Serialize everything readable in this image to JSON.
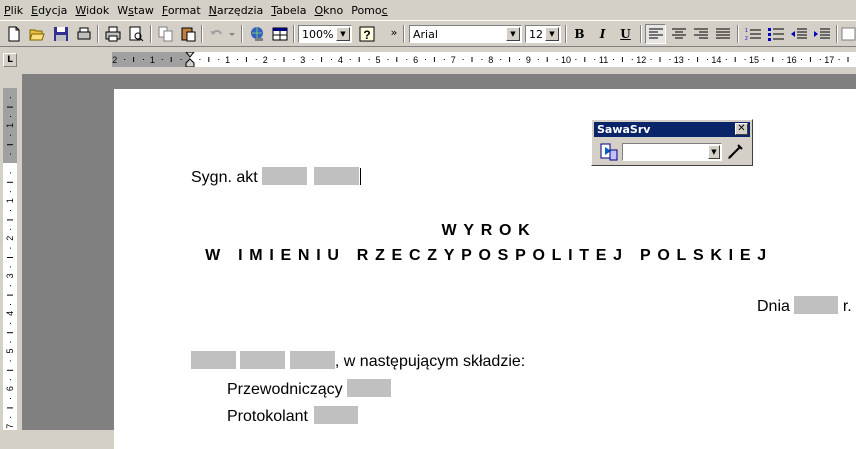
{
  "menu": [
    {
      "pre": "",
      "acc": "P",
      "post": "lik"
    },
    {
      "pre": "",
      "acc": "E",
      "post": "dycja"
    },
    {
      "pre": "",
      "acc": "W",
      "post": "idok"
    },
    {
      "pre": "W",
      "acc": "s",
      "post": "taw"
    },
    {
      "pre": "",
      "acc": "F",
      "post": "ormat"
    },
    {
      "pre": "",
      "acc": "N",
      "post": "arzędzia"
    },
    {
      "pre": "",
      "acc": "T",
      "post": "abela"
    },
    {
      "pre": "",
      "acc": "O",
      "post": "kno"
    },
    {
      "pre": "Pomo",
      "acc": "c",
      "post": ""
    }
  ],
  "toolbar": {
    "zoom": "100%",
    "font": "Arial",
    "size": "12",
    "bold": "B",
    "italic": "I",
    "underline": "U",
    "more": "»"
  },
  "ruler": {
    "corner": "L",
    "h_labels": [
      "2",
      "1",
      "1",
      "2",
      "3",
      "4",
      "5",
      "6",
      "7",
      "8",
      "9",
      "10",
      "11",
      "12",
      "13",
      "14",
      "15",
      "16",
      "17"
    ],
    "v_labels": [
      "2",
      "1",
      "1",
      "2",
      "3",
      "4",
      "5",
      "6",
      "7"
    ]
  },
  "float_toolbar": {
    "title": "SawaSrv",
    "close": "✕",
    "combo_value": ""
  },
  "document": {
    "sygn_label": "Sygn. akt",
    "title": "WYROK",
    "subtitle": "W IMIENIU RZECZYPOSPOLITEJ POLSKIEJ",
    "date_label": "Dnia",
    "date_suffix": "r.",
    "composition_text": ", w następującym składzie:",
    "chair_label": "Przewodniczący",
    "clerk_label": "Protokolant"
  },
  "colors": {
    "title_bar": "#0a246a",
    "field_gray": "#c0c0c0",
    "workspace": "#808080"
  }
}
